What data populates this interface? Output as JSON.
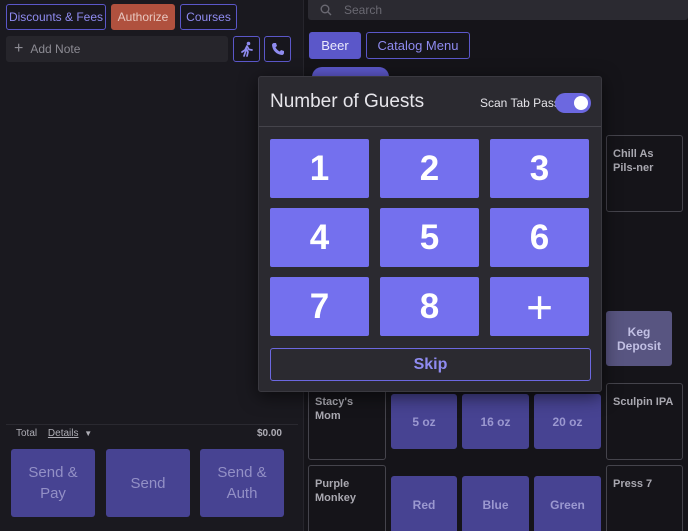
{
  "order_panel": {
    "buttons": {
      "discounts_fees": "Discounts & Fees",
      "authorize": "Authorize",
      "courses": "Courses"
    },
    "note_placeholder": "Add Note",
    "icons": [
      "walking-person-icon",
      "phone-icon"
    ],
    "total": {
      "label": "Total",
      "details_label": "Details",
      "amount": "$0.00"
    },
    "actions": [
      "Send & Pay",
      "Send",
      "Send & Auth"
    ]
  },
  "catalog": {
    "search_placeholder": "Search",
    "tabs": [
      {
        "label": "Beer",
        "active": true
      },
      {
        "label": "Catalog Menu",
        "active": false
      }
    ],
    "items": {
      "chill_as_pilsner": "Chill As Pils-ner",
      "keg_deposit": "Keg Deposit",
      "stacys_mom": "Stacy's Mom",
      "sculpin_ipa": "Sculpin IPA",
      "purple_monkey": "Purple Monkey",
      "press_7": "Press 7",
      "size_5oz": "5 oz",
      "size_16oz": "16 oz",
      "size_20oz": "20 oz",
      "red": "Red",
      "blue": "Blue",
      "green": "Green"
    }
  },
  "guests_modal": {
    "title": "Number of Guests",
    "scan_tab_pass_label": "Scan Tab Pass",
    "scan_tab_pass_enabled": true,
    "numbers": [
      "1",
      "2",
      "3",
      "4",
      "5",
      "6",
      "7",
      "8",
      "+"
    ],
    "skip_label": "Skip"
  },
  "colors": {
    "accent": "#7470ee",
    "authorize": "#b0513e",
    "background": "#151419"
  }
}
